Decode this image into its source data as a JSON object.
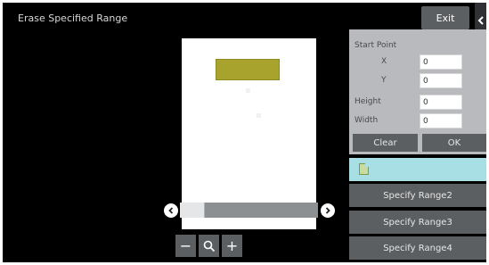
{
  "window": {
    "title": "Erase Specified Range"
  },
  "toolbar": {
    "exit_label": "Exit"
  },
  "panel": {
    "start_point_label": "Start Point",
    "x_label": "X",
    "y_label": "Y",
    "height_label": "Height",
    "width_label": "Width",
    "x_value": "0",
    "y_value": "0",
    "height_value": "0",
    "width_value": "0",
    "clear_label": "Clear",
    "ok_label": "OK"
  },
  "ranges": {
    "range1_label": "",
    "range2_label": "Specify Range2",
    "range3_label": "Specify Range3",
    "range4_label": "Specify Range4"
  },
  "zoom": {
    "minus": "−",
    "plus": "+"
  },
  "icons": [
    "chevron-left-icon",
    "arrow-left-icon",
    "arrow-right-icon",
    "magnifier-icon",
    "document-icon"
  ],
  "colors": {
    "mark_fill": "#a7a32c",
    "active_range": "#a8dfe5",
    "button": "#5c5f62",
    "panel": "#b8babd"
  }
}
